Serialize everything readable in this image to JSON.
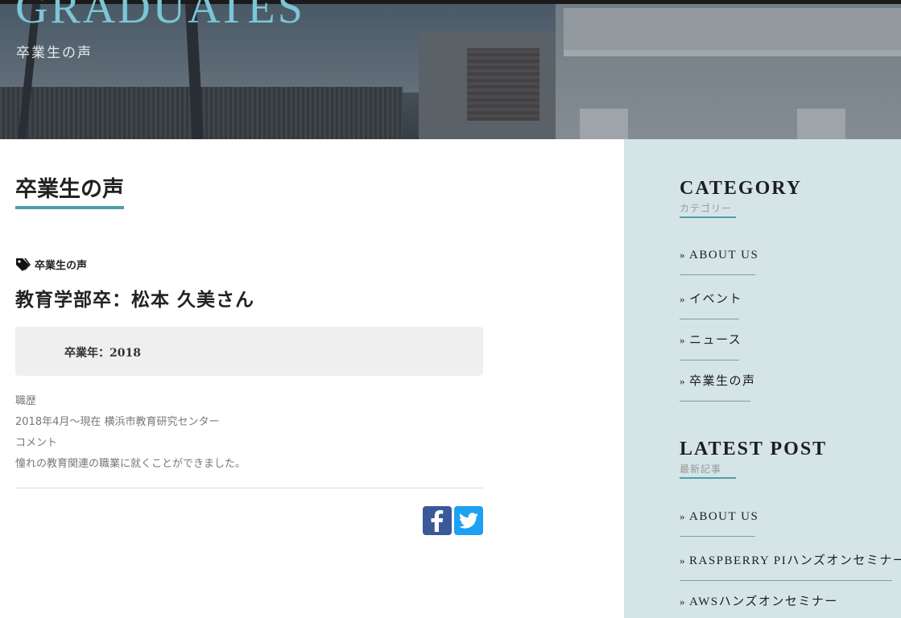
{
  "hero": {
    "title": "GRADUATES",
    "subtitle": "卒業生の声"
  },
  "main": {
    "page_title": "卒業生の声",
    "category_tag": "卒業生の声",
    "post_title": "教育学部卒：松本 久美さん",
    "info_box": "卒業年：2018",
    "body_lines": [
      "職歴",
      "2018年4月～現在 横浜市教育研究センター",
      "コメント",
      "憧れの教育関連の職業に就くことができました。"
    ],
    "share": {
      "facebook_icon": "facebook-icon",
      "twitter_icon": "twitter-icon",
      "facebook_color": "#3b5998",
      "twitter_color": "#1da1f2"
    }
  },
  "sidebar": {
    "category": {
      "heading": "CATEGORY",
      "subheading": "カテゴリー",
      "items": [
        "ABOUT US",
        "イベント",
        "ニュース",
        "卒業生の声"
      ]
    },
    "latest": {
      "heading": "LATEST POST",
      "subheading": "最新記事",
      "items": [
        "ABOUT US",
        "RASPBERRY PIハンズオンセミナー",
        "AWSハンズオンセミナー"
      ]
    },
    "chevron": "»"
  },
  "colors": {
    "accent": "#4e9ea6",
    "hero_title": "#7cc6d6",
    "sidebar_bg": "#d5e4e7"
  }
}
